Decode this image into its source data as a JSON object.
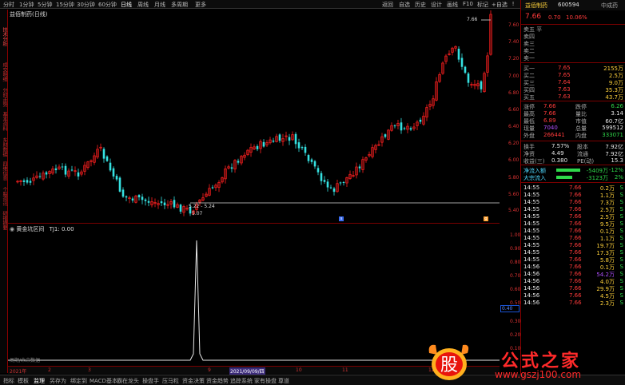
{
  "toolbar": {
    "items": [
      "分时",
      "1分钟",
      "5分钟",
      "15分钟",
      "30分钟",
      "60分钟",
      "日线",
      "周线",
      "月线",
      "多周期",
      "更多"
    ],
    "active_index": 6,
    "right_items": [
      "返回",
      "自选",
      "历史",
      "设计",
      "画线",
      "F10",
      "标记",
      "+自选",
      "ǃ"
    ]
  },
  "sidebar": {
    "items": [
      "技术分析",
      "基本资料",
      "成交明细",
      "分时走势",
      "买卖力道",
      "东财数据",
      "四维信息",
      "个股资讯",
      "研报摘要"
    ]
  },
  "main_chart": {
    "title": "益佰制药(日线)",
    "high_label": "7.66",
    "low_range_label": "5.22 - 5.24",
    "low_label": "5.07",
    "price_axis": [
      "7.60",
      "7.40",
      "7.20",
      "7.00",
      "6.80",
      "6.60",
      "6.40",
      "6.20",
      "6.00",
      "5.80",
      "5.60",
      "5.40"
    ],
    "colors": {
      "up": "#ff2020",
      "down": "#35e0e0",
      "bg": "#000000"
    }
  },
  "oscillator": {
    "title": "黄金坑区间",
    "value_label": "TJ1: 0.00",
    "axis": [
      "1.00",
      "0.90",
      "0.80",
      "0.70",
      "0.60",
      "0.50",
      "0.40",
      "0.30",
      "0.20",
      "0.10"
    ],
    "boxed_value": "0.40",
    "note": "周期/未来数据"
  },
  "date_bar": {
    "labels": [
      "2021年",
      "2",
      "3",
      "9",
      "2021/09/09/四",
      "10",
      "11",
      "12"
    ]
  },
  "bottom_tabs": {
    "items": [
      "指标",
      "模板",
      "监理",
      "另存为",
      "绑定到",
      "MACD基本",
      "霸在龙头",
      "操盘手",
      "压马粒",
      "资金决策",
      "资金趋势",
      "追踪系统",
      "家有操盘",
      "尊道"
    ]
  },
  "quote": {
    "name": "益佰制药",
    "code": "600594",
    "tag": "中成药",
    "price": "7.66",
    "change": "0.70",
    "pct": "10.06%",
    "sell_label": "卖五 平",
    "ask": [
      {
        "label": "卖四",
        "price": "",
        "vol": ""
      },
      {
        "label": "卖三",
        "price": "",
        "vol": ""
      },
      {
        "label": "卖二",
        "price": "",
        "vol": ""
      },
      {
        "label": "卖一",
        "price": "",
        "vol": ""
      }
    ],
    "bid": [
      {
        "label": "买一",
        "price": "7.65",
        "vol": "2155万"
      },
      {
        "label": "买二",
        "price": "7.65",
        "vol": "2.5万"
      },
      {
        "label": "买三",
        "price": "7.64",
        "vol": "9.0万"
      },
      {
        "label": "买四",
        "price": "7.63",
        "vol": "35.3万"
      },
      {
        "label": "买五",
        "price": "7.63",
        "vol": "43.7万"
      }
    ],
    "stats": [
      {
        "l1": "涨停",
        "v1": "7.66",
        "l2": "跌停",
        "v2": "6.26"
      },
      {
        "l1": "最高",
        "v1": "7.66",
        "l2": "量比",
        "v2": "3.14"
      },
      {
        "l1": "最低",
        "v1": "6.89",
        "l2": "市值",
        "v2": "60.7亿"
      },
      {
        "l1": "现量",
        "v1": "7040",
        "l2": "总量",
        "v2": "599512"
      },
      {
        "l1": "外盘",
        "v1": "266441",
        "l2": "内盘",
        "v2": "333071"
      }
    ],
    "stats2": [
      {
        "l1": "换手",
        "v1": "7.57%",
        "l2": "股本",
        "v2": "7.92亿"
      },
      {
        "l1": "净资",
        "v1": "4.49",
        "l2": "流通",
        "v2": "7.92亿"
      },
      {
        "l1": "收益(三)",
        "v1": "0.380",
        "l2": "PE(动)",
        "v2": "15.3"
      }
    ],
    "flow": [
      {
        "label": "净流入额",
        "value": "-5409万",
        "pct": "-12%"
      },
      {
        "label": "大宗流入",
        "value": "-3123万",
        "pct": "2%"
      }
    ],
    "ticks": [
      {
        "t": "14:55",
        "p": "7.66",
        "v": "0.2万",
        "s": "S"
      },
      {
        "t": "14:55",
        "p": "7.66",
        "v": "1.1万",
        "s": "S"
      },
      {
        "t": "14:55",
        "p": "7.66",
        "v": "7.3万",
        "s": "S"
      },
      {
        "t": "14:55",
        "p": "7.66",
        "v": "2.5万",
        "s": "S"
      },
      {
        "t": "14:55",
        "p": "7.66",
        "v": "2.5万",
        "s": "S"
      },
      {
        "t": "14:55",
        "p": "7.66",
        "v": "9.5万",
        "s": "S"
      },
      {
        "t": "14:55",
        "p": "7.66",
        "v": "0.1万",
        "s": "S"
      },
      {
        "t": "14:55",
        "p": "7.66",
        "v": "1.1万",
        "s": "S"
      },
      {
        "t": "14:55",
        "p": "7.66",
        "v": "19.7万",
        "s": "S"
      },
      {
        "t": "14:55",
        "p": "7.66",
        "v": "17.3万",
        "s": "S"
      },
      {
        "t": "14:55",
        "p": "7.66",
        "v": "5.8万",
        "s": "S"
      },
      {
        "t": "14:56",
        "p": "7.66",
        "v": "0.1万",
        "s": "S"
      },
      {
        "t": "14:56",
        "p": "7.66",
        "v": "54.2万",
        "s": "S"
      },
      {
        "t": "14:56",
        "p": "7.66",
        "v": "4.0万",
        "s": "S"
      },
      {
        "t": "14:56",
        "p": "7.66",
        "v": "29.9万",
        "s": "S"
      },
      {
        "t": "14:56",
        "p": "7.66",
        "v": "4.5万",
        "s": "S"
      },
      {
        "t": "14:56",
        "p": "7.66",
        "v": "2.3万",
        "s": "S"
      }
    ]
  },
  "watermark": {
    "logo_char": "股",
    "title": "公式之家",
    "url": "www.gszj100.com"
  }
}
